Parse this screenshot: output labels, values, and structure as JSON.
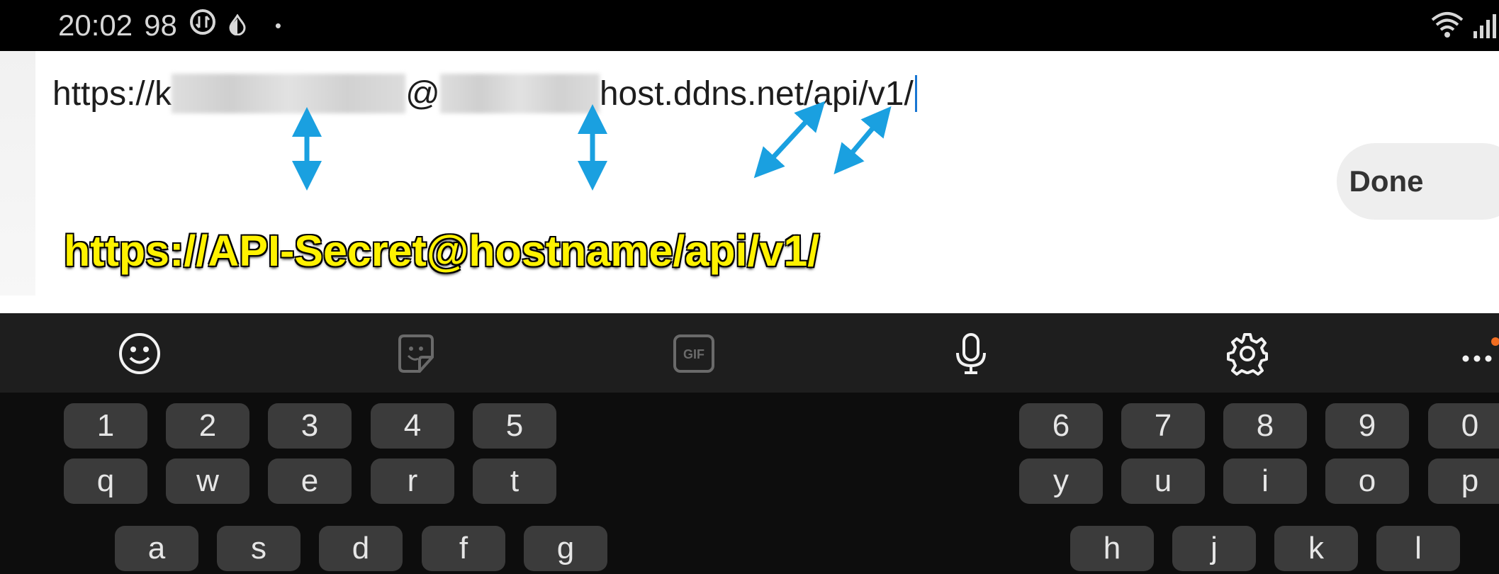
{
  "status_bar": {
    "time": "20:02",
    "battery": "98",
    "dot": "•"
  },
  "url_field": {
    "prefix": "https://",
    "visible_char": "k",
    "at": "@",
    "suffix": "host.ddns.net/api/v1/"
  },
  "annotation_text": "https://API-Secret@hostname/api/v1/",
  "done_label": "Done",
  "toolbar_icons": [
    "emoji-icon",
    "sticker-icon",
    "gif-icon",
    "microphone-icon",
    "settings-icon",
    "more-icon"
  ],
  "gif_label": "GIF",
  "keyboard": {
    "row_numbers_left": [
      "1",
      "2",
      "3",
      "4",
      "5"
    ],
    "row_numbers_right": [
      "6",
      "7",
      "8",
      "9",
      "0"
    ],
    "row_top_left": [
      "q",
      "w",
      "e",
      "r",
      "t"
    ],
    "row_top_right": [
      "y",
      "u",
      "i",
      "o",
      "p"
    ],
    "row_home_left": [
      "a",
      "s",
      "d",
      "f",
      "g"
    ],
    "row_home_right": [
      "h",
      "j",
      "k",
      "l"
    ]
  },
  "colors": {
    "annotation": "#fff200",
    "arrow": "#1aa0e0",
    "caret": "#1976d2",
    "notification_dot": "#f26d21"
  }
}
